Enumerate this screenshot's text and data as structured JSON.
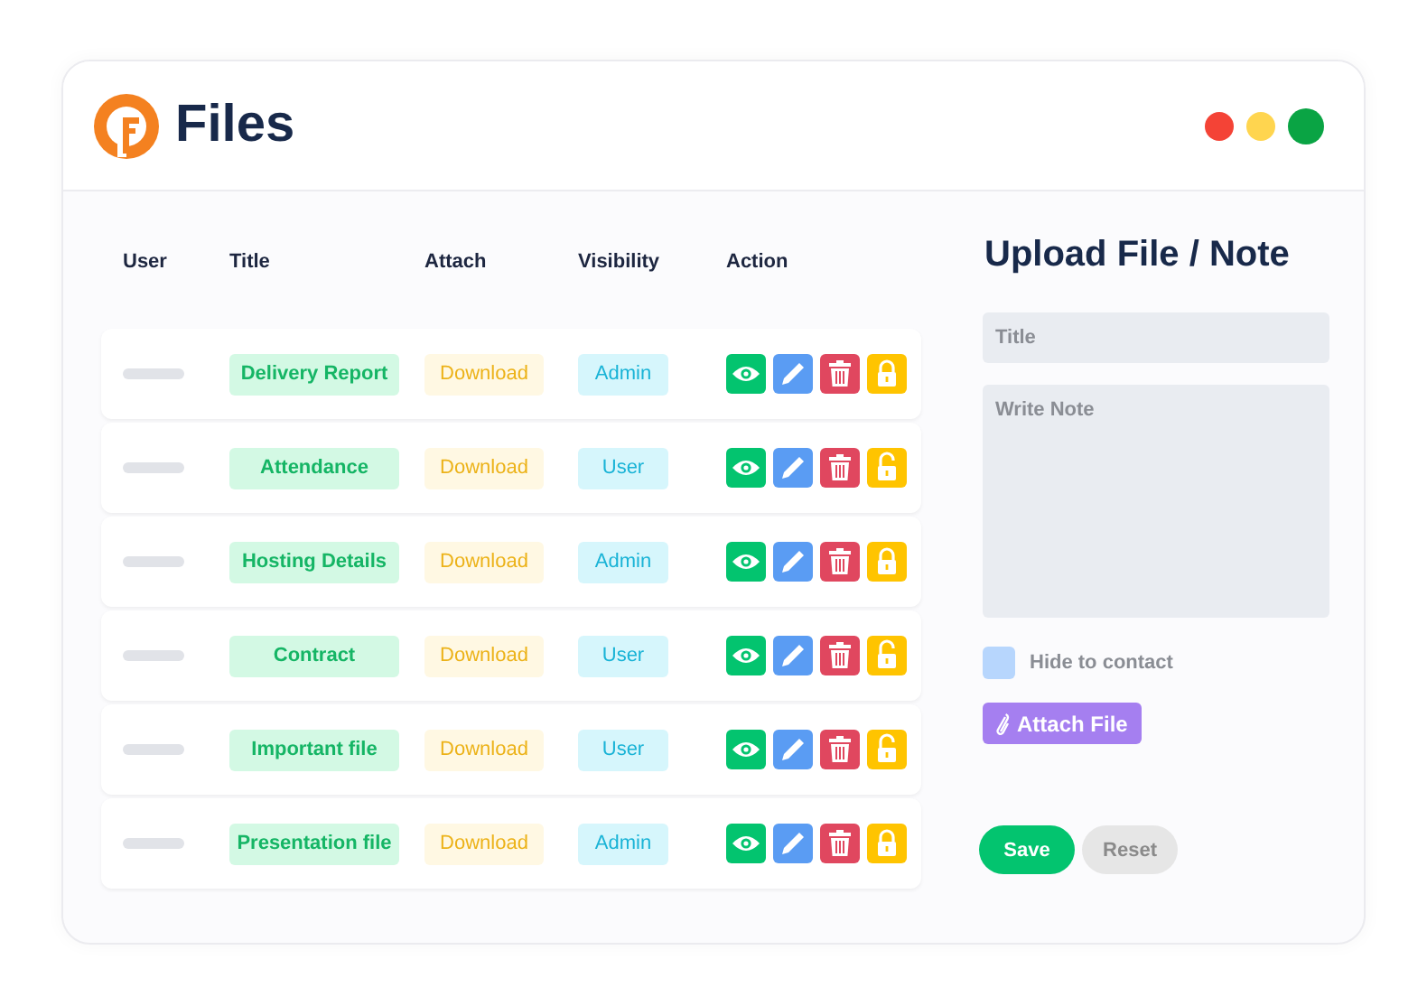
{
  "app": {
    "title": "Files"
  },
  "window_controls": [
    {
      "color": "#f44336"
    },
    {
      "color": "#ffd54f"
    },
    {
      "color": "#0aa444"
    }
  ],
  "table": {
    "columns": [
      "User",
      "Title",
      "Attach",
      "Visibility",
      "Action"
    ],
    "rows": [
      {
        "title": "Delivery Report",
        "attach": "Download",
        "visibility": "Admin",
        "locked": true
      },
      {
        "title": "Attendance",
        "attach": "Download",
        "visibility": "User",
        "locked": false
      },
      {
        "title": "Hosting Details",
        "attach": "Download",
        "visibility": "Admin",
        "locked": true
      },
      {
        "title": "Contract",
        "attach": "Download",
        "visibility": "User",
        "locked": false
      },
      {
        "title": "Important file",
        "attach": "Download",
        "visibility": "User",
        "locked": false
      },
      {
        "title": "Presentation file",
        "attach": "Download",
        "visibility": "Admin",
        "locked": true
      }
    ]
  },
  "form": {
    "heading": "Upload File / Note",
    "title_field": {
      "placeholder": "Title"
    },
    "note_field": {
      "placeholder": "Write Note"
    },
    "hide_checkbox": {
      "label": "Hide to contact",
      "checked": false
    },
    "attach_button": "Attach File",
    "buttons": [
      "Save",
      "Reset"
    ]
  }
}
